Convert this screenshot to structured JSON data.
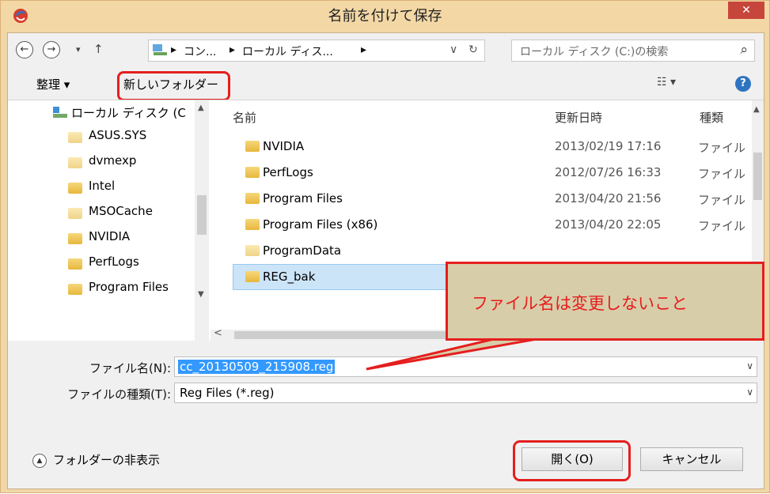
{
  "window": {
    "title": "名前を付けて保存",
    "close_label": "✕"
  },
  "nav": {
    "back": "←",
    "forward": "→",
    "recent": "▾",
    "up": "↑",
    "path": [
      "コン...",
      "ローカル ディス..."
    ],
    "path_sep": "▸",
    "addr_dropdown": "∨",
    "refresh": "↻",
    "search_placeholder": "ローカル ディスク (C:)の検索",
    "search_icon": "⌕"
  },
  "toolbar": {
    "organize": "整理 ▾",
    "new_folder": "新しいフォルダー",
    "view_icon": "☷ ▾",
    "help": "?"
  },
  "tree": {
    "header": "ローカル ディスク (C",
    "items": [
      {
        "label": "ASUS.SYS",
        "pale": true
      },
      {
        "label": "dvmexp",
        "pale": true
      },
      {
        "label": "Intel",
        "pale": false
      },
      {
        "label": "MSOCache",
        "pale": true
      },
      {
        "label": "NVIDIA",
        "pale": false
      },
      {
        "label": "PerfLogs",
        "pale": false
      },
      {
        "label": "Program Files",
        "pale": false
      }
    ]
  },
  "list": {
    "columns": {
      "name": "名前",
      "date": "更新日時",
      "type": "種類"
    },
    "rows": [
      {
        "name": "NVIDIA",
        "date": "2013/02/19 17:16",
        "type": "ファイル"
      },
      {
        "name": "PerfLogs",
        "date": "2012/07/26 16:33",
        "type": "ファイル"
      },
      {
        "name": "Program Files",
        "date": "2013/04/20 21:56",
        "type": "ファイル"
      },
      {
        "name": "Program Files (x86)",
        "date": "2013/04/20 22:05",
        "type": "ファイル"
      },
      {
        "name": "ProgramData",
        "date": "",
        "type": ""
      },
      {
        "name": "REG_bak",
        "date": "",
        "type": ""
      }
    ],
    "selected_row": "REG_bak"
  },
  "callout": {
    "text": "ファイル名は変更しないこと"
  },
  "form": {
    "filename_label": "ファイル名(N):",
    "filename_value": "cc_20130509_215908.reg",
    "filetype_label": "ファイルの種類(T):",
    "filetype_value": "Reg Files (*.reg)",
    "dropdown_arrow": "∨"
  },
  "footer": {
    "hide_folders": "フォルダーの非表示",
    "open": "開く(O)",
    "cancel": "キャンセル"
  },
  "colors": {
    "highlight": "#e51e1e",
    "selection": "#3399ff",
    "title_bg": "#f3d8a6"
  }
}
